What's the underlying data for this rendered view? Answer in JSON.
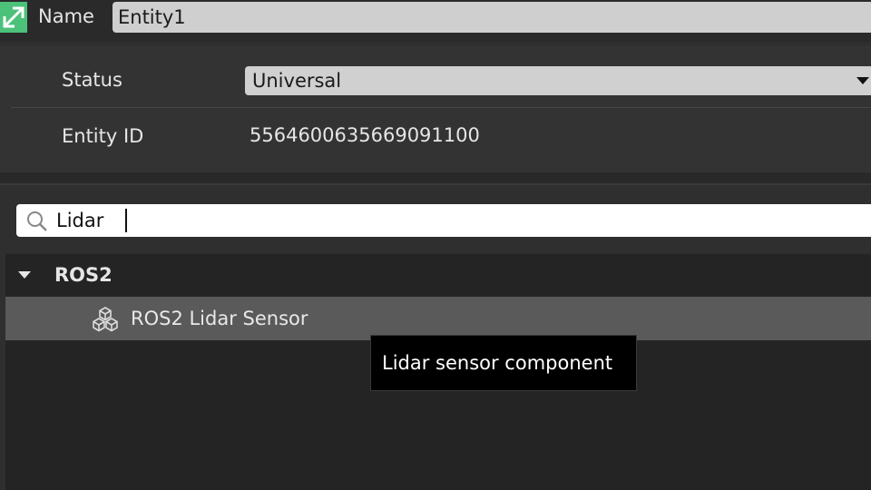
{
  "header": {
    "name_label": "Name",
    "name_value": "Entity1"
  },
  "properties": {
    "status_label": "Status",
    "status_value": "Universal",
    "entity_id_label": "Entity ID",
    "entity_id_value": "5564600635669091100"
  },
  "search": {
    "value": "Lidar"
  },
  "tree": {
    "group_label": "ROS2",
    "item_label": "ROS2 Lidar Sensor",
    "item_icon": "component-cubes-icon"
  },
  "tooltip": {
    "text": "Lidar sensor component"
  },
  "colors": {
    "entity_icon": "#4cc17a",
    "highlight_row": "#5a5a5a",
    "tooltip_bg": "#000000"
  }
}
